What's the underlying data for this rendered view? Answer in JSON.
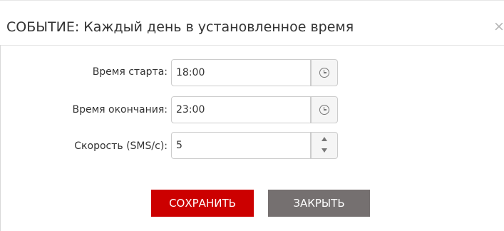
{
  "dialog": {
    "title": "СОБЫТИЕ: Каждый день в установленное время",
    "close_glyph": "×"
  },
  "fields": {
    "start_time": {
      "label": "Время старта:",
      "value": "18:00",
      "icon": "clock-icon"
    },
    "end_time": {
      "label": "Время окончания:",
      "value": "23:00",
      "icon": "clock-icon"
    },
    "speed": {
      "label": "Скорость (SMS/с):",
      "value": "5",
      "icon": "spinner-arrows"
    }
  },
  "buttons": {
    "save_label": "СОХРАНИТЬ",
    "close_label": "ЗАКРЫТЬ"
  },
  "colors": {
    "save_button": "#cc0000",
    "close_button": "#757070"
  }
}
